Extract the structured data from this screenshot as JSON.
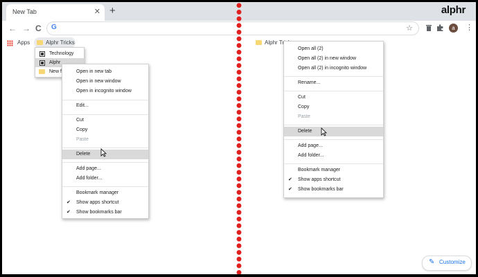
{
  "tab": {
    "title": "New Tab",
    "close_glyph": "✕"
  },
  "new_tab_glyph": "+",
  "logo": {
    "text": "alphr"
  },
  "toolbar": {
    "back": "←",
    "forward": "→",
    "reload": "C",
    "omnibox_placeholder": "",
    "star": "☆",
    "avatar": "a",
    "menu_dots": "⋮"
  },
  "bookmarks_bar": {
    "apps_label": "Apps",
    "left_folder_label": "Alphr Tricks",
    "right_folder_label": "Alphr Tricks"
  },
  "folder_dropdown": {
    "items": [
      "Technology",
      "Alphr",
      "New f"
    ]
  },
  "left_menu": {
    "open_new_tab": "Open in new tab",
    "open_new_window": "Open in new window",
    "open_incognito": "Open in incognito window",
    "edit": "Edit...",
    "cut": "Cut",
    "copy": "Copy",
    "paste": "Paste",
    "delete": "Delete",
    "add_page": "Add page...",
    "add_folder": "Add folder...",
    "bookmark_manager": "Bookmark manager",
    "show_apps_shortcut": "Show apps shortcut",
    "show_bookmarks_bar": "Show bookmarks bar"
  },
  "right_menu": {
    "open_all": "Open all (2)",
    "open_all_window": "Open all (2) in new window",
    "open_all_incognito": "Open all (2) in incognito window",
    "rename": "Rename...",
    "cut": "Cut",
    "copy": "Copy",
    "paste": "Paste",
    "delete": "Delete",
    "add_page": "Add page...",
    "add_folder": "Add folder...",
    "bookmark_manager": "Bookmark manager",
    "show_apps_shortcut": "Show apps shortcut",
    "show_bookmarks_bar": "Show bookmarks bar"
  },
  "check_glyph": "✔",
  "customize": {
    "label": "Customize",
    "icon": "pencil-icon"
  },
  "colors": {
    "divider_dot": "#e0201f",
    "accent": "#1a73e8",
    "highlight": "#d9d9d9"
  }
}
